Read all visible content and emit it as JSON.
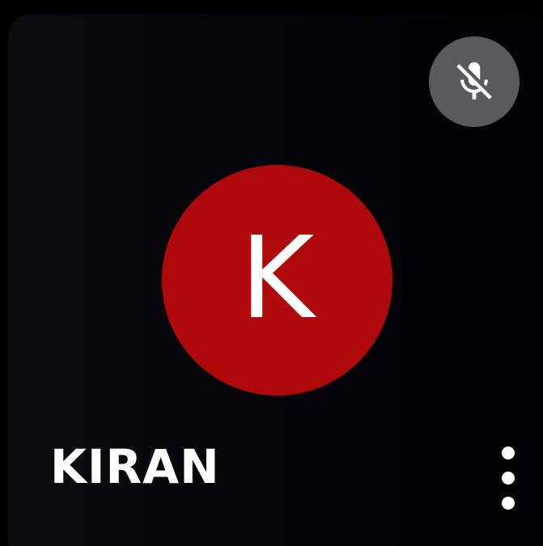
{
  "participant": {
    "name": "KIRAN",
    "avatar_letter": "K",
    "avatar_color": "#b0090b"
  },
  "status": {
    "mic_icon": "mic-off-icon",
    "muted": true
  },
  "menu": {
    "icon": "more-vert-icon"
  }
}
